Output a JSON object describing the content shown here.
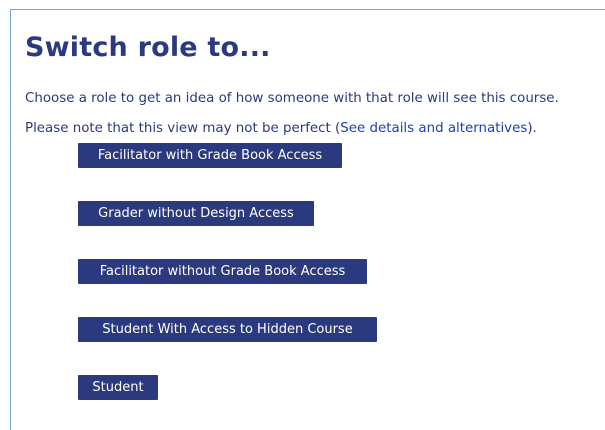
{
  "heading": "Switch role to...",
  "description": "Choose a role to get an idea of how someone with that role will see this course.",
  "note": {
    "before": "Please note that this view may not be perfect (",
    "link": "See details and alternatives",
    "after": ")."
  },
  "roles": [
    {
      "label": "Facilitator with Grade Book Access"
    },
    {
      "label": "Grader without Design Access"
    },
    {
      "label": "Facilitator without Grade Book Access"
    },
    {
      "label": "Student With Access to Hidden Course"
    },
    {
      "label": "Student"
    }
  ],
  "colors": {
    "heading": "#2b3a7e",
    "button_bg": "#2b3a7e",
    "link": "#1a3fb8",
    "border": "#7aa3d6"
  }
}
